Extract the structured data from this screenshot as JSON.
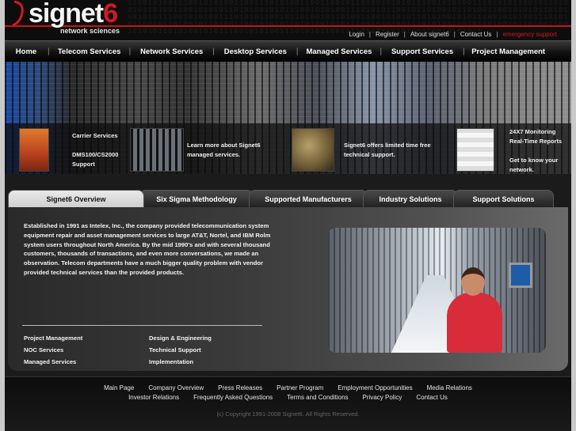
{
  "brand": {
    "name_main": "signet",
    "name_num": "6",
    "tagline": "network sciences"
  },
  "header_binary": "1100101001110010101001100111010100110011001011010010101011100101010011101010110010110100101101001100101010110101001010111001010100111010101100101101001011010011001010101101010010101110010101001110101011001011010010110100110010101011010100101011100101010011101010110010110100101101001100101010110101001010111001010100111010101100101101001011010011001010101101010010101110010101001110101011001011010010110100110010101011",
  "toplinks": [
    {
      "label": "Login"
    },
    {
      "label": "Register"
    },
    {
      "label": "About signet6"
    },
    {
      "label": "Contact Us"
    },
    {
      "label": "emergency support"
    }
  ],
  "mainnav": [
    {
      "label": "Home"
    },
    {
      "label": "Telecom Services"
    },
    {
      "label": "Network Services"
    },
    {
      "label": "Desktop Services"
    },
    {
      "label": "Managed Services"
    },
    {
      "label": "Support Services"
    },
    {
      "label": "Project Management"
    }
  ],
  "hero": {
    "carrier_title": "Carrier Services",
    "carrier_sub_1": "DMS100/CS2000",
    "carrier_sub_2": "Support",
    "managed_1": "Learn more about Signet6",
    "managed_2": "managed services.",
    "support_1": "Signet6 offers limited time free",
    "support_2": "technical support.",
    "monitor_1": "24X7 Monitoring",
    "monitor_2": "Real-Time Reports",
    "monitor_3": "Get to know your",
    "monitor_4": "network."
  },
  "tabs": [
    {
      "label": "Signet6 Overview",
      "active": true
    },
    {
      "label": "Six Sigma Methodology"
    },
    {
      "label": "Supported Manufacturers"
    },
    {
      "label": "Industry Solutions"
    },
    {
      "label": "Support Solutions"
    }
  ],
  "overview": {
    "paragraph": "Established in 1991 as Intelex, Inc., the company provided telecommunication system equipment repair and asset management services to large AT&T, Nortel, and IBM Rolm system users throughout North America. By the mid 1990's and with several thousand customers, thousands of transactions, and even more conversations, we made an observation. Telecom departments have a much bigger quality problem with vendor provided technical services than the provided products.",
    "services": [
      "Project Management",
      "Design & Engineering",
      "NOC Services",
      "Technical Support",
      "Managed Services",
      "Implementation"
    ]
  },
  "footer": {
    "row1": [
      "Main Page",
      "Company Overview",
      "Press Releases",
      "Partner Program",
      "Employment Opportunities",
      "Media Relations"
    ],
    "row2": [
      "Investor Relations",
      "Frequently Asked Questions",
      "Terms and Conditions",
      "Privacy Policy",
      "Contact Us"
    ],
    "copyright": "(c) Copyright 1991-2008 Signet6. All Rights Reserved."
  },
  "colors": {
    "brand_red": "#d11a22",
    "background": "#1b1b1b"
  }
}
